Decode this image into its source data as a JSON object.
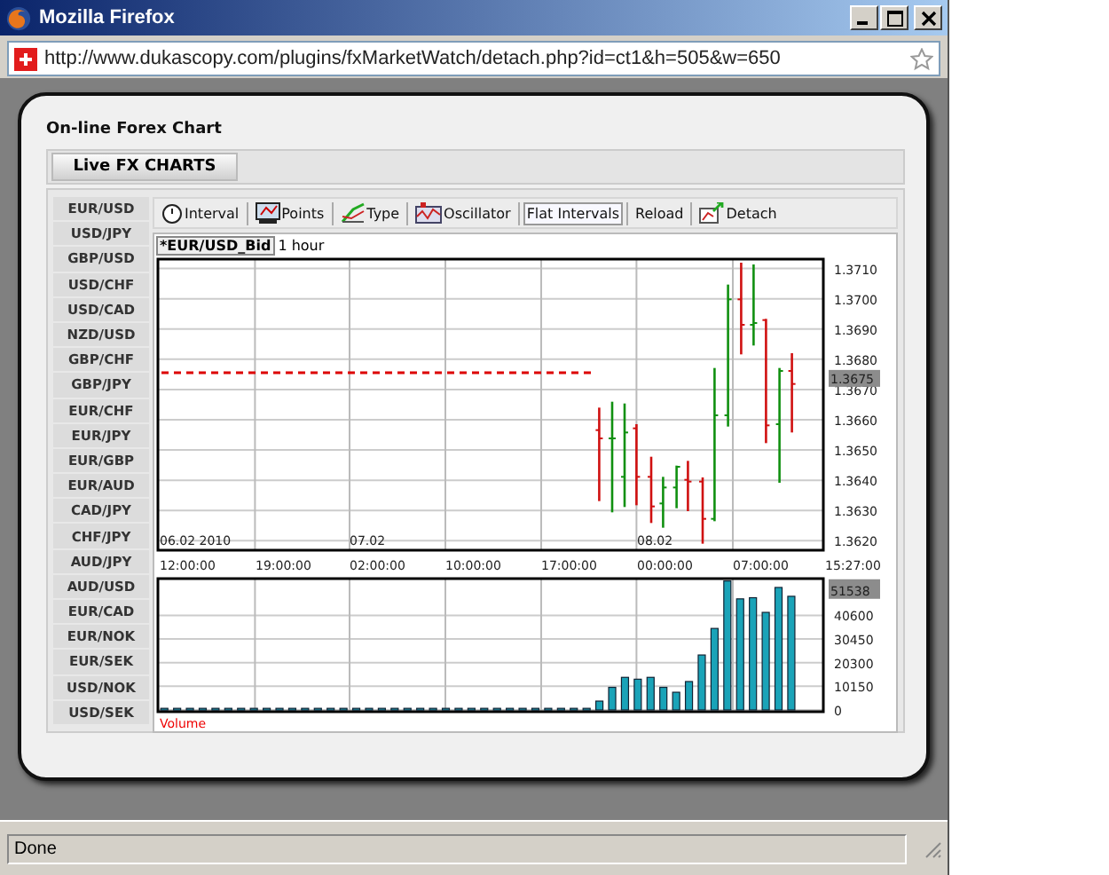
{
  "window": {
    "title": "Mozilla Firefox"
  },
  "address_bar": {
    "url": "http://www.dukascopy.com/plugins/fxMarketWatch/detach.php?id=ct1&h=505&w=650"
  },
  "page": {
    "heading": "On-line Forex Chart",
    "tabs": [
      {
        "label": "Live FX CHARTS",
        "selected": true
      }
    ],
    "pairs": [
      "EUR/USD",
      "USD/JPY",
      "GBP/USD",
      "USD/CHF",
      "USD/CAD",
      "NZD/USD",
      "GBP/CHF",
      "GBP/JPY",
      "EUR/CHF",
      "EUR/JPY",
      "EUR/GBP",
      "EUR/AUD",
      "CAD/JPY",
      "CHF/JPY",
      "AUD/JPY",
      "AUD/USD",
      "EUR/CAD",
      "EUR/NOK",
      "EUR/SEK",
      "USD/NOK",
      "USD/SEK"
    ],
    "toolbar": [
      {
        "label": "Interval",
        "kind": "interval",
        "selected": false
      },
      {
        "label": "Points",
        "kind": "points",
        "selected": false
      },
      {
        "label": "Type",
        "kind": "type",
        "selected": false
      },
      {
        "label": "Oscillator",
        "kind": "oscillator",
        "selected": false
      },
      {
        "label": "Flat Intervals",
        "kind": "plain",
        "selected": true
      },
      {
        "label": "Reload",
        "kind": "plain",
        "selected": false
      },
      {
        "label": "Detach",
        "kind": "detach",
        "selected": false
      }
    ],
    "instrument": "*EUR/USD_Bid",
    "period": "1 hour",
    "price_chart": {
      "price_labels": [
        "1.3710",
        "1.3700",
        "1.3690",
        "1.3680",
        "1.3670",
        "1.3660",
        "1.3650",
        "1.3640",
        "1.3630",
        "1.3620"
      ],
      "current_price": "1.3675",
      "date_labels": [
        "06.02 2010",
        "07.02",
        "08.02"
      ]
    },
    "time_labels": [
      "12:00:00",
      "19:00:00",
      "02:00:00",
      "10:00:00",
      "17:00:00",
      "00:00:00",
      "07:00:00",
      "15:27:00"
    ],
    "volume_chart": {
      "last_volume": "51538",
      "label": "Volume",
      "chart_data": {
        "type": "bar",
        "grid": true,
        "ylim": [
          0,
          56400
        ],
        "yticks": [
          {
            "value": 0,
            "label": "0"
          },
          10150,
          20300,
          30450,
          40600
        ],
        "values": [
          700,
          700,
          700,
          700,
          700,
          700,
          700,
          700,
          700,
          700,
          700,
          700,
          700,
          700,
          700,
          700,
          700,
          700,
          700,
          700,
          700,
          700,
          700,
          700,
          700,
          700,
          700,
          700,
          700,
          700,
          700,
          700,
          700,
          700,
          3800,
          9700,
          14000,
          13200,
          14000,
          9700,
          7600,
          12200,
          23600,
          35000,
          55400,
          47700,
          48200,
          41900,
          52600,
          48800,
          null,
          null
        ]
      }
    }
  },
  "status_bar": {
    "text": "Done"
  }
}
